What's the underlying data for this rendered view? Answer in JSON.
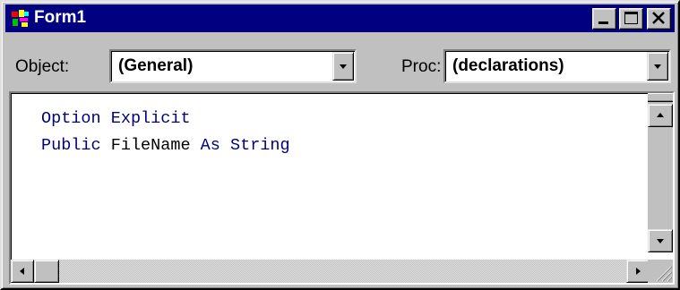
{
  "window": {
    "title": "Form1",
    "icon": "vb-form-icon",
    "buttons": {
      "minimize": "minimize-icon",
      "maximize": "maximize-icon",
      "close": "close-icon"
    }
  },
  "toolbar": {
    "object_label": "Object:",
    "object_value": "(General)",
    "proc_label": "Proc:",
    "proc_value": "(declarations)"
  },
  "code": {
    "lines": [
      {
        "keyword1": "Option",
        "sep1": " ",
        "keyword2": "Explicit",
        "rest": ""
      },
      {
        "keyword1": "Public",
        "name": "FileName",
        "keyword2": "As",
        "type": "String"
      }
    ]
  },
  "colors": {
    "titlebar": "#000080",
    "face": "#c0c0c0",
    "keyword": "#00007f",
    "code_text": "#000000",
    "editor_bg": "#ffffff"
  }
}
